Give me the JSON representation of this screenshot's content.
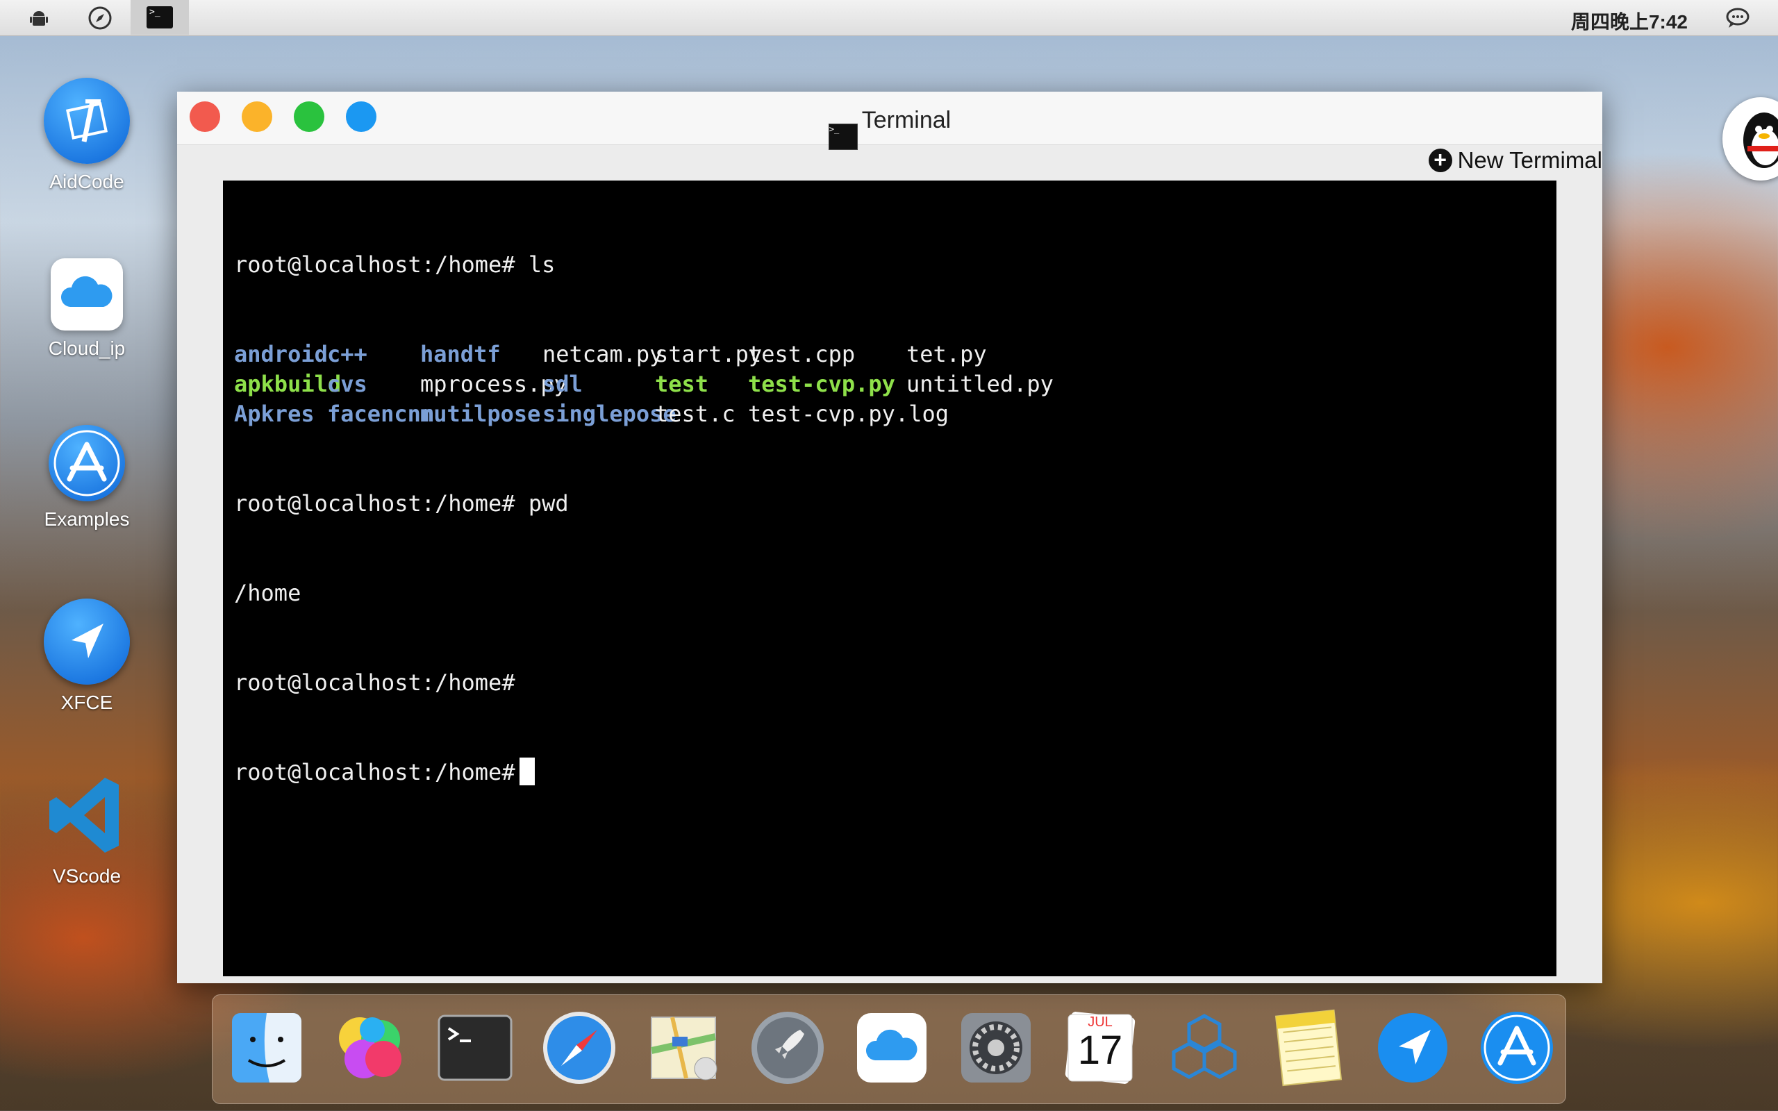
{
  "menubar": {
    "icons": [
      "android-icon",
      "compass-icon",
      "terminal-icon"
    ],
    "clock": "周四晚上7:42",
    "chat_icon": "chat-bubble-icon"
  },
  "desktop": {
    "icons": [
      {
        "label": "AidCode",
        "icon": "aidcode-icon"
      },
      {
        "label": "Cloud_ip",
        "icon": "cloud-icon"
      },
      {
        "label": "Examples",
        "icon": "app-store-icon"
      },
      {
        "label": "XFCE",
        "icon": "xfce-arrow-icon"
      },
      {
        "label": "VScode",
        "icon": "vscode-icon"
      }
    ]
  },
  "window": {
    "title": "Terminal",
    "new_terminal_label": "New Termimal",
    "traffic_light_colors": [
      "#f25a4e",
      "#fbb32a",
      "#2ac23e",
      "#1b98f2"
    ]
  },
  "terminal": {
    "prompt": "root@localhost:/home#",
    "cmd1": "ls",
    "ls_rows": [
      [
        {
          "t": "android",
          "k": "dir"
        },
        {
          "t": "c++",
          "k": "dir"
        },
        {
          "t": "handtf",
          "k": "dir"
        },
        {
          "t": "netcam.py",
          "k": "file"
        },
        {
          "t": "start.py",
          "k": "file"
        },
        {
          "t": "test.cpp",
          "k": "file"
        },
        {
          "t": "tet.py",
          "k": "file"
        }
      ],
      [
        {
          "t": "apkbuild",
          "k": "exe"
        },
        {
          "t": "cvs",
          "k": "dir"
        },
        {
          "t": "mprocess.py",
          "k": "file"
        },
        {
          "t": "sdl",
          "k": "dir"
        },
        {
          "t": "test",
          "k": "exe"
        },
        {
          "t": "test-cvp.py",
          "k": "exe"
        },
        {
          "t": "untitled.py",
          "k": "file"
        }
      ],
      [
        {
          "t": "Apkres",
          "k": "dir"
        },
        {
          "t": "facencnn",
          "k": "dir"
        },
        {
          "t": "mutilpose",
          "k": "dir"
        },
        {
          "t": "singlepose",
          "k": "dir"
        },
        {
          "t": "test.c",
          "k": "file"
        },
        {
          "t": "test-cvp.py.log",
          "k": "file"
        },
        {
          "t": "",
          "k": "file"
        }
      ]
    ],
    "cmd2": "pwd",
    "pwd_output": "/home",
    "colors": {
      "dir": "#7b9fd6",
      "exe": "#8ee04a",
      "file": "#f0f0f0"
    }
  },
  "dock": {
    "items": [
      "finder-icon",
      "game-center-icon",
      "terminal-icon",
      "safari-icon",
      "maps-icon",
      "launchpad-icon",
      "icloud-icon",
      "system-preferences-icon",
      "calendar-icon",
      "cubes-icon",
      "notes-icon",
      "xfce-arrow-icon",
      "app-store-icon"
    ],
    "calendar_month": "JUL",
    "calendar_day": "17"
  }
}
